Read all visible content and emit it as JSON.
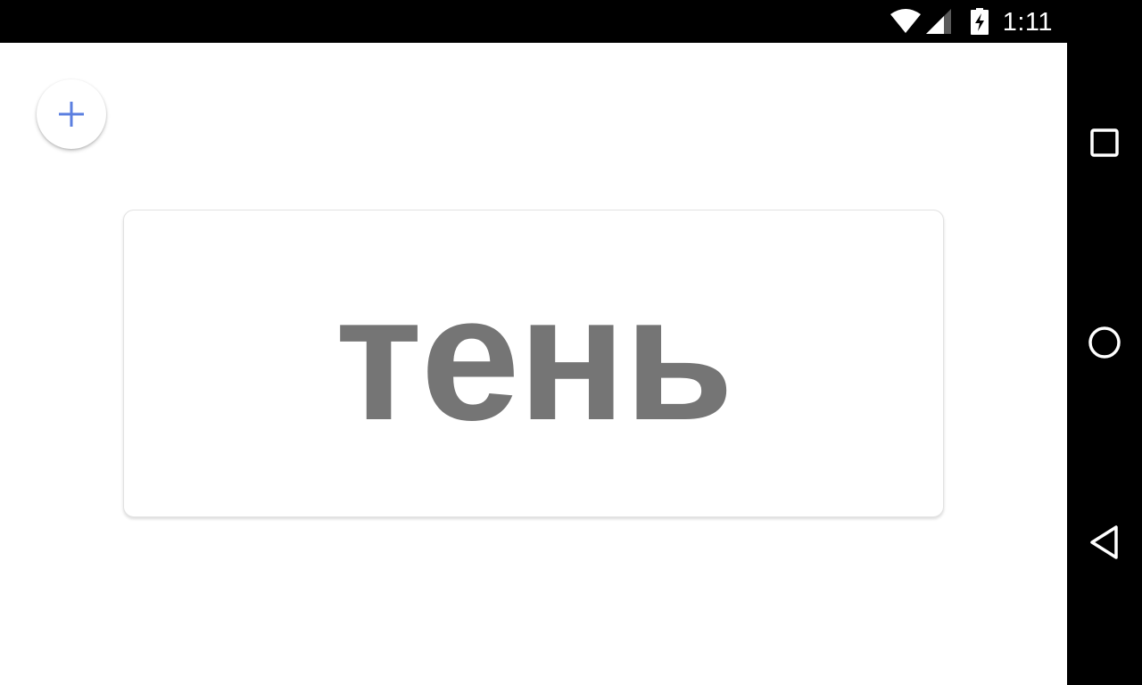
{
  "status_bar": {
    "time": "1:11",
    "icons": [
      "wifi-icon",
      "cellular-signal-icon",
      "battery-charging-icon"
    ]
  },
  "fab": {
    "icon": "plus-icon",
    "color": "#5b7fe0"
  },
  "card": {
    "word": "тень",
    "text_color": "#757575"
  },
  "nav_bar": {
    "buttons": [
      "recents-icon",
      "home-icon",
      "back-icon"
    ]
  }
}
